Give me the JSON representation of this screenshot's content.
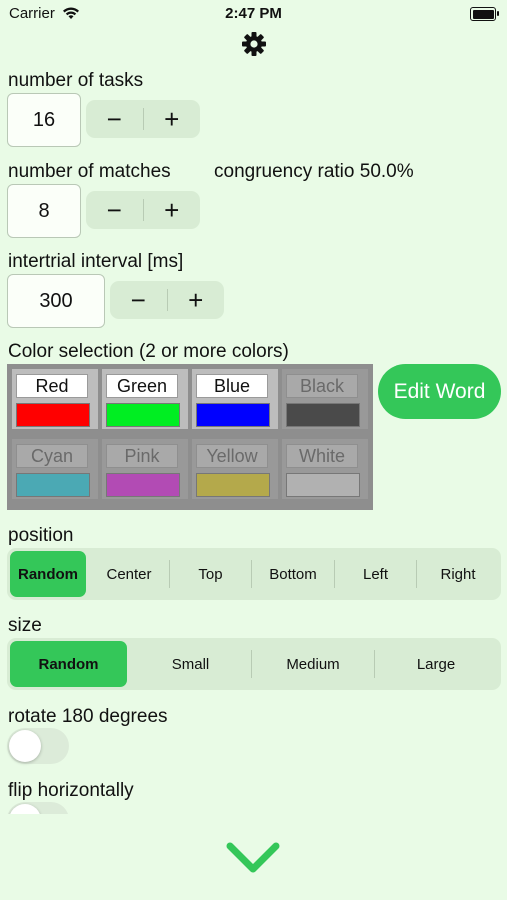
{
  "status_bar": {
    "carrier": "Carrier",
    "time": "2:47 PM"
  },
  "settings": {
    "tasks": {
      "label": "number of tasks",
      "value": "16"
    },
    "matches": {
      "label": "number of matches",
      "value": "8",
      "ratio_text": "congruency ratio 50.0%"
    },
    "interval": {
      "label": "intertrial interval [ms]",
      "value": "300"
    },
    "stepper": {
      "minus": "−",
      "plus": "+"
    }
  },
  "colors": {
    "label": "Color selection (2 or more colors)",
    "items": [
      {
        "name": "Red",
        "swatch": "#ff0000",
        "enabled": true
      },
      {
        "name": "Green",
        "swatch": "#00ee22",
        "enabled": true
      },
      {
        "name": "Blue",
        "swatch": "#0000ff",
        "enabled": true
      },
      {
        "name": "Black",
        "swatch": "#4a4a4a",
        "enabled": false
      },
      {
        "name": "Cyan",
        "swatch": "#4ba9b4",
        "enabled": false
      },
      {
        "name": "Pink",
        "swatch": "#b24bb4",
        "enabled": false
      },
      {
        "name": "Yellow",
        "swatch": "#b4a94b",
        "enabled": false
      },
      {
        "name": "White",
        "swatch": "#b1b1b1",
        "enabled": false
      }
    ],
    "edit_word": "Edit Word"
  },
  "position": {
    "label": "position",
    "options": [
      "Random",
      "Center",
      "Top",
      "Bottom",
      "Left",
      "Right"
    ],
    "selected": "Random"
  },
  "size": {
    "label": "size",
    "options": [
      "Random",
      "Small",
      "Medium",
      "Large"
    ],
    "selected": "Random"
  },
  "rotate": {
    "label": "rotate 180 degrees",
    "on": false
  },
  "flip": {
    "label": "flip horizontally",
    "on": false
  },
  "theme": {
    "accent": "#34c759",
    "background": "#e9fbe6"
  }
}
